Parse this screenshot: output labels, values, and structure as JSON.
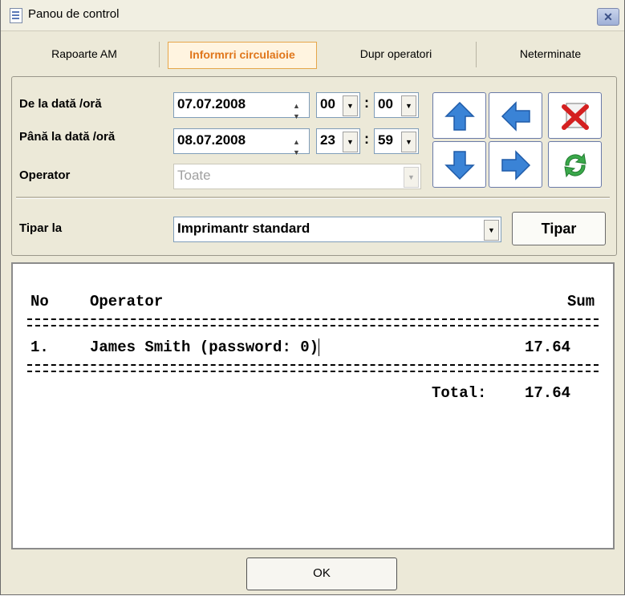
{
  "window": {
    "title": "Panou de control",
    "close_symbol": "✕"
  },
  "tabs": [
    "Rapoarte AM",
    "Informrri circulaioie",
    "Dupr operatori",
    "Neterminate"
  ],
  "filters": {
    "from_label": "De la dată /oră",
    "to_label": "Până la dată /oră",
    "operator_label": "Operator",
    "from_date": "07.07.2008",
    "from_hour": "00",
    "from_minute": "00",
    "to_date": "08.07.2008",
    "to_hour": "23",
    "to_minute": "59",
    "operator_value": "Toate"
  },
  "print": {
    "label": "Tipar la",
    "printer": "Imprimantr standard",
    "button": "Tipar"
  },
  "report": {
    "col_no": "No",
    "col_operator": "Operator",
    "col_sum": "Sum",
    "rows": [
      {
        "no": "1.",
        "operator": "James Smith (password: 0)",
        "sum": "17.64"
      }
    ],
    "total_label": "Total:",
    "total_value": "17.64"
  },
  "ok_button": "OK",
  "colors": {
    "tab_active": "#e0761b",
    "arrow_blue": "#3a83d6"
  }
}
